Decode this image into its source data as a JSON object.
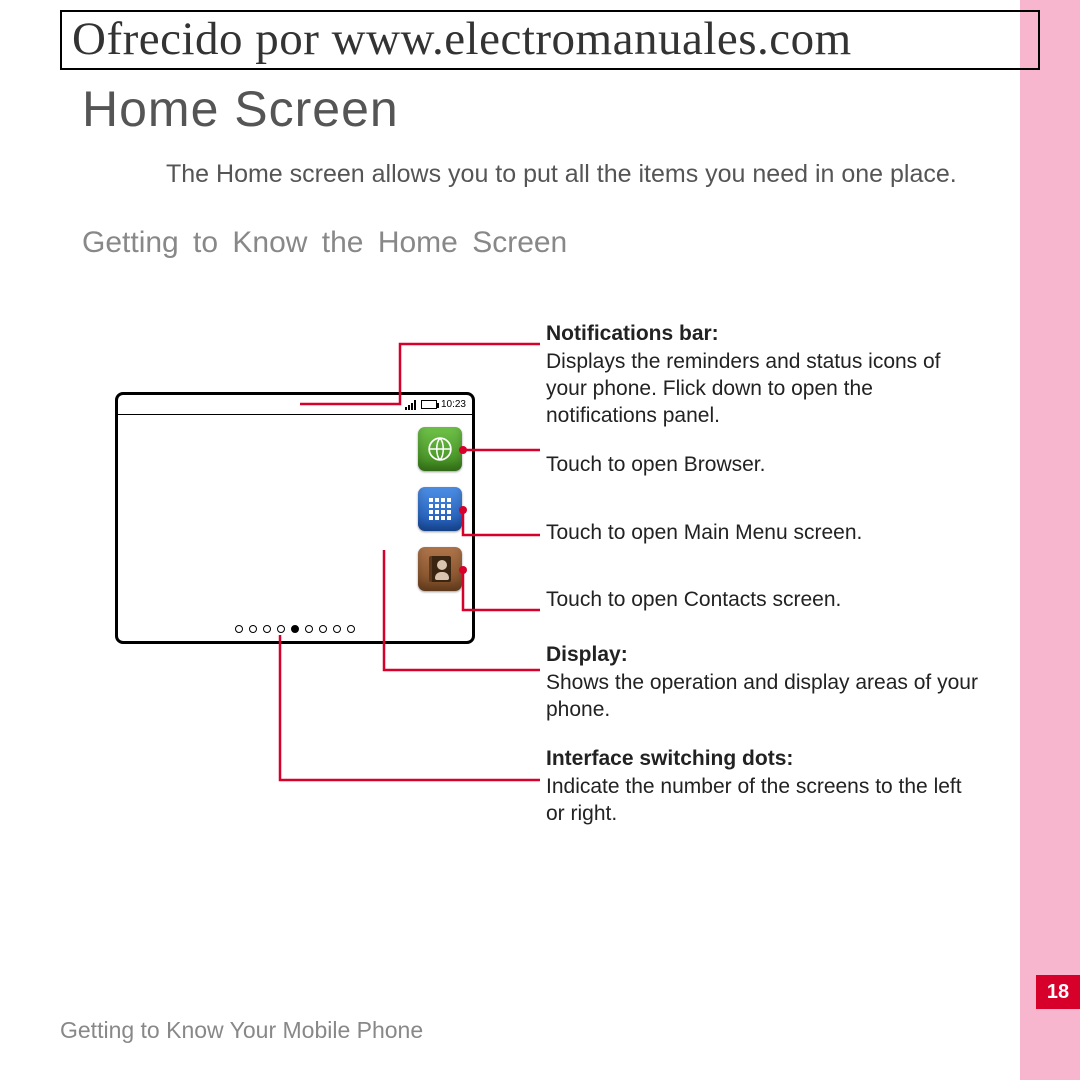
{
  "header": {
    "provided_by": "Ofrecido por www.electromanuales.com"
  },
  "title": "Home Screen",
  "intro": "The Home screen allows you to put all the items you need in one place.",
  "subsection": "Getting to Know the Home Screen",
  "phone": {
    "time": "10:23"
  },
  "callouts": {
    "notifications_label": "Notifications bar:",
    "notifications_desc": "Displays the reminders and status icons of your phone. Flick down to open the notifications panel.",
    "browser_desc": "Touch to open Browser.",
    "menu_desc": "Touch to open Main Menu screen.",
    "contacts_desc": "Touch to open Contacts screen.",
    "display_label": "Display:",
    "display_desc": "Shows the operation and display areas of your phone.",
    "dots_label": "Interface switching dots:",
    "dots_desc": "Indicate the number of the screens to the left or right."
  },
  "footer": "Getting to Know Your Mobile Phone",
  "page_number": "18"
}
